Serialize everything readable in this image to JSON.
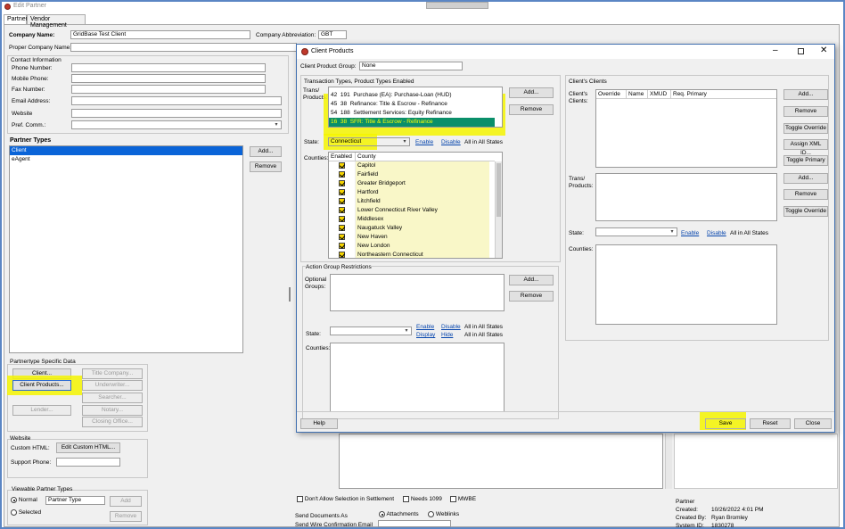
{
  "window": {
    "title": "Edit Partner"
  },
  "tabs": [
    {
      "label": "Partner"
    },
    {
      "label": "Vendor Management"
    }
  ],
  "partner": {
    "company_name_label": "Company Name:",
    "company_name": "GridBase Test Client",
    "company_abbr_label": "Company Abbreviation:",
    "company_abbr": "GBT",
    "proper_name_label": "Proper Company Name:",
    "contact_header": "Contact Information",
    "contact_fields": [
      "Phone Number:",
      "Mobile Phone:",
      "Fax Number:",
      "Email Address:",
      "Website",
      "Pref. Comm.:"
    ],
    "partner_types_label": "Partner Types",
    "partner_types": [
      "Client",
      "eAgent"
    ],
    "add_label": "Add...",
    "remove_label": "Remove",
    "specific_label": "Partnertype Specific Data",
    "client_btn": "Client...",
    "client_products_btn": "Client Products...",
    "lender_btn": "Lender...",
    "title_company_btn": "Title Company...",
    "underwriter_btn": "Underwriter...",
    "searcher_btn": "Searcher...",
    "notary_btn": "Notary...",
    "closing_office_btn": "Closing Office...",
    "website_label": "Website",
    "custom_html_label": "Custom HTML:",
    "edit_custom_html_btn": "Edit Custom HTML...",
    "support_phone_label": "Support Phone:",
    "viewable_label": "Viewable Partner Types",
    "normal_label": "Normal",
    "selected_label": "Selected",
    "partner_type_col": "Partner Type",
    "add_btn": "Add",
    "remove_btn": "Remove"
  },
  "bottom": {
    "dont_allow": "Don't Allow Selection in Settlement",
    "needs_1099": "Needs 1099",
    "mwbe": "MWBE",
    "send_docs_label": "Send Documents As",
    "attachments": "Attachments",
    "weblinks": "Weblinks",
    "send_wire_label": "Send Wire Confirmation Email",
    "partner_label": "Partner",
    "created_label": "Created:",
    "created_value": "10/26/2022 4:01 PM",
    "created_by_label": "Created By:",
    "created_by_value": "Ryan Bromley",
    "system_id_label": "System ID:",
    "system_id_value": "1830278"
  },
  "dialog": {
    "title": "Client Products",
    "group_label": "Client Product Group:",
    "group_value": "None",
    "tt_header": "Transaction Types, Product Types Enabled",
    "trans_label": "Trans/ Products:",
    "trans_rows": [
      {
        "a": "42",
        "b": "191",
        "text": "Purchase (EA): Purchase-Loan (HUD)"
      },
      {
        "a": "45",
        "b": "38",
        "text": "Refinance: Title & Escrow - Refinance"
      },
      {
        "a": "54",
        "b": "188",
        "text": "Settlement Services: Equity Refinance"
      },
      {
        "a": "16",
        "b": "38",
        "text": "SFR: Title & Escrow - Refinance"
      }
    ],
    "add_label": "Add...",
    "remove_label": "Remove",
    "state_label": "State:",
    "state_value": "Connecticut",
    "enable": "Enable",
    "disable": "Disable",
    "all_states": "All in All States",
    "counties_label": "Counties:",
    "col_enabled": "Enabled",
    "col_county": "County",
    "counties": [
      "Capitol",
      "Fairfield",
      "Greater Bridgeport",
      "Hartford",
      "Litchfield",
      "Lower Connecticut River Valley",
      "Middlesex",
      "Naugatuck Valley",
      "New Haven",
      "New London",
      "Northeastern Connecticut"
    ],
    "agr_header": "Action Group Restrictions",
    "optional_groups": "Optional Groups:",
    "agr_state": "State:",
    "agr_enable": "Enable",
    "agr_disable": "Disable",
    "agr_all": "All in All States",
    "agr_display": "Display",
    "agr_hide": "Hide",
    "agr_counties": "Counties:",
    "cc_header": "Client's Clients",
    "cc_label": "Client's Clients:",
    "cc_cols": [
      "Override",
      "Name",
      "XMUD",
      "Req. Primary"
    ],
    "cc_buttons": [
      "Add...",
      "Remove",
      "Toggle Override",
      "Assign XML ID...",
      "Toggle Primary"
    ],
    "cc_trans": "Trans/ Products:",
    "cc_buttons2": [
      "Add...",
      "Remove",
      "Toggle Override"
    ],
    "cc_state": "State:",
    "cc_enable": "Enable",
    "cc_disable": "Disable",
    "cc_all": "All in All States",
    "cc_counties": "Counties:",
    "help": "Help",
    "save": "Save",
    "reset": "Reset",
    "close": "Close"
  }
}
